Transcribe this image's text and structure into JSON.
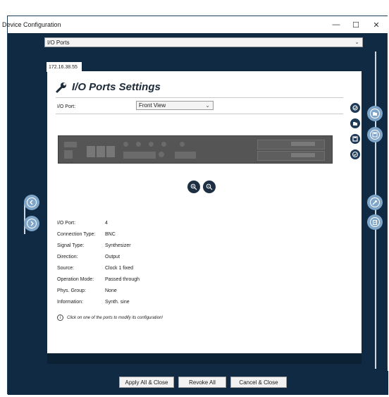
{
  "window": {
    "title": "Device Configuration",
    "minimize": "—",
    "maximize": "☐",
    "close": "✕"
  },
  "port_select": {
    "value": "I/O Ports"
  },
  "tab": {
    "label": "172.16.38.55"
  },
  "settings": {
    "heading": "I/O Ports Settings",
    "port_label": "I/O Port:",
    "view_value": "Front View"
  },
  "details": [
    {
      "label": "I/O Port:",
      "value": "4"
    },
    {
      "label": "Connection Type:",
      "value": "BNC"
    },
    {
      "label": "Signal Type:",
      "value": "Synthesizer"
    },
    {
      "label": "Direction:",
      "value": "Output"
    },
    {
      "label": "Source:",
      "value": "Clock 1 fixed"
    },
    {
      "label": "Operation Mode:",
      "value": "Passed through"
    },
    {
      "label": "Phys. Group:",
      "value": "None"
    },
    {
      "label": "Information:",
      "value": "Synth. sine"
    }
  ],
  "hint": {
    "icon": "i",
    "text": "Click on one of the ports to modify its configuration!"
  },
  "actions": {
    "apply": "Apply All & Close",
    "revoke": "Revoke All",
    "cancel": "Cancel & Close"
  },
  "icons": {
    "panel_tools": [
      "settings-check-icon",
      "open-file-icon",
      "save-icon",
      "verify-icon"
    ],
    "zoom": [
      "zoom-in-icon",
      "zoom-out-icon"
    ],
    "right_nav": [
      "open-file-icon",
      "save-icon",
      "wrench-icon",
      "clipboard-icon"
    ],
    "left_nav": [
      "previous-icon",
      "next-icon"
    ]
  },
  "colors": {
    "frame": "#0f2a42",
    "accent": "#7fa6c9",
    "button_dark": "#1d2f43"
  }
}
